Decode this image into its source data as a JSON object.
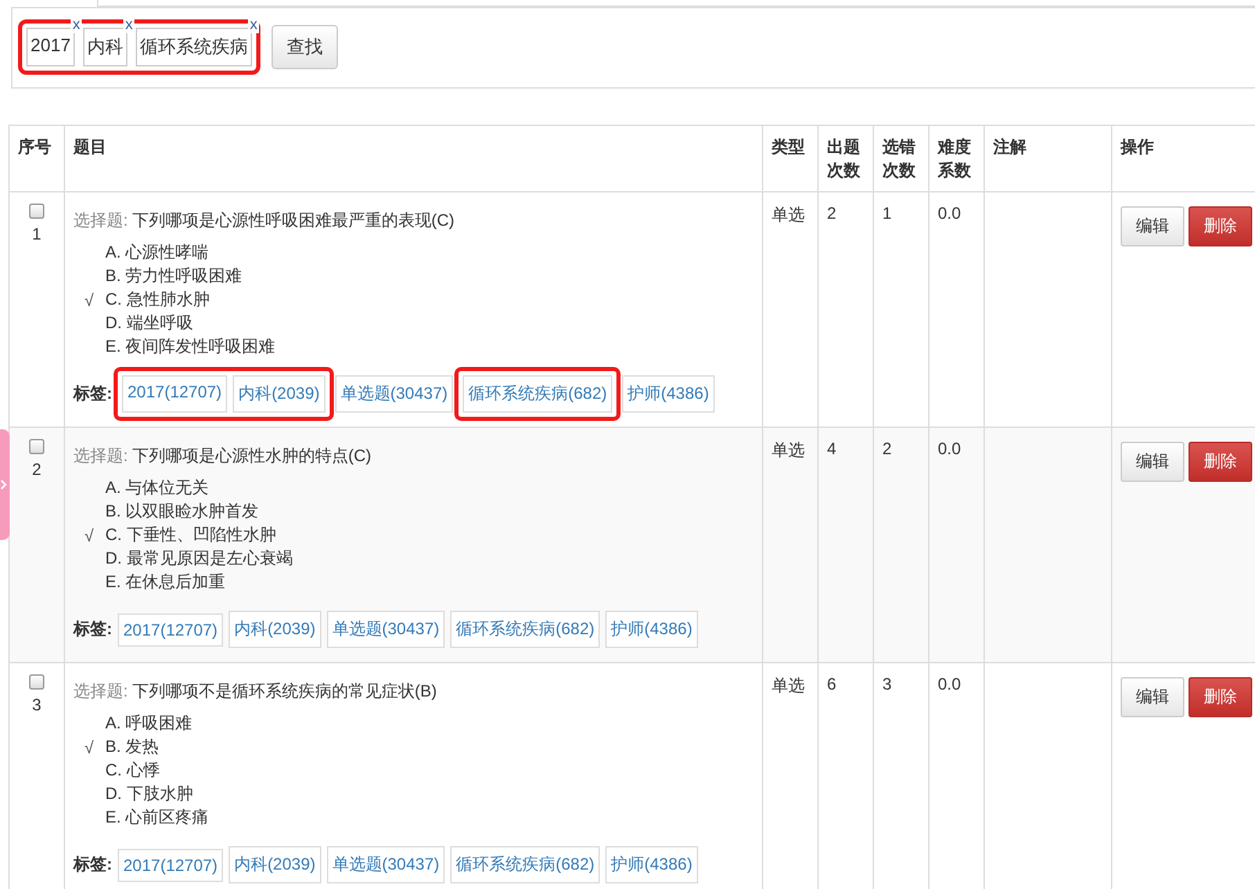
{
  "filters": {
    "highlighted": true,
    "chips": [
      {
        "label": "2017",
        "remove": "x"
      },
      {
        "label": "内科",
        "remove": "x"
      },
      {
        "label": "循环系统疾病",
        "remove": "x"
      }
    ],
    "search_button": "查找"
  },
  "table": {
    "columns": [
      "序号",
      "题目",
      "类型",
      "出题次数",
      "选错次数",
      "难度系数",
      "注解",
      "操作"
    ],
    "rows": [
      {
        "number": "1",
        "checked": false,
        "type_prefix": "选择题:",
        "question": "下列哪项是心源性呼吸困难最严重的表现(C)",
        "options": [
          {
            "text": "A. 心源性哮喘",
            "correct": false
          },
          {
            "text": "B. 劳力性呼吸困难",
            "correct": false
          },
          {
            "text": "C. 急性肺水肿",
            "correct": true
          },
          {
            "text": "D. 端坐呼吸",
            "correct": false
          },
          {
            "text": "E. 夜间阵发性呼吸困难",
            "correct": false
          }
        ],
        "correct_mark": "√",
        "tags_label": "标签:",
        "tags": [
          {
            "text": "2017(12707)",
            "highlighted": true
          },
          {
            "text": "内科(2039)",
            "highlighted": true
          },
          {
            "text": "单选题(30437)",
            "highlighted": false
          },
          {
            "text": "循环系统疾病(682)",
            "highlighted": true
          },
          {
            "text": "护师(4386)",
            "highlighted": false
          }
        ],
        "kind": "单选",
        "asked": "2",
        "wrong": "1",
        "difficulty": "0.0",
        "note_text": "",
        "edit": "编辑",
        "delete": "删除"
      },
      {
        "number": "2",
        "checked": false,
        "type_prefix": "选择题:",
        "question": "下列哪项是心源性水肿的特点(C)",
        "options": [
          {
            "text": "A. 与体位无关",
            "correct": false
          },
          {
            "text": "B. 以双眼睑水肿首发",
            "correct": false
          },
          {
            "text": "C. 下垂性、凹陷性水肿",
            "correct": true
          },
          {
            "text": "D. 最常见原因是左心衰竭",
            "correct": false
          },
          {
            "text": "E. 在休息后加重",
            "correct": false
          }
        ],
        "correct_mark": "√",
        "tags_label": "标签:",
        "tags": [
          {
            "text": "2017(12707)",
            "highlighted": false
          },
          {
            "text": "内科(2039)",
            "highlighted": false
          },
          {
            "text": "单选题(30437)",
            "highlighted": false
          },
          {
            "text": "循环系统疾病(682)",
            "highlighted": false
          },
          {
            "text": "护师(4386)",
            "highlighted": false
          }
        ],
        "kind": "单选",
        "asked": "4",
        "wrong": "2",
        "difficulty": "0.0",
        "note_text": "",
        "edit": "编辑",
        "delete": "删除"
      },
      {
        "number": "3",
        "checked": false,
        "type_prefix": "选择题:",
        "question": "下列哪项不是循环系统疾病的常见症状(B)",
        "options": [
          {
            "text": "A. 呼吸困难",
            "correct": false
          },
          {
            "text": "B. 发热",
            "correct": true
          },
          {
            "text": "C. 心悸",
            "correct": false
          },
          {
            "text": "D. 下肢水肿",
            "correct": false
          },
          {
            "text": "E. 心前区疼痛",
            "correct": false
          }
        ],
        "correct_mark": "√",
        "tags_label": "标签:",
        "tags": [
          {
            "text": "2017(12707)",
            "highlighted": false
          },
          {
            "text": "内科(2039)",
            "highlighted": false
          },
          {
            "text": "单选题(30437)",
            "highlighted": false
          },
          {
            "text": "循环系统疾病(682)",
            "highlighted": false
          },
          {
            "text": "护师(4386)",
            "highlighted": false
          }
        ],
        "kind": "单选",
        "asked": "6",
        "wrong": "3",
        "difficulty": "0.0",
        "note_text": "",
        "edit": "编辑",
        "delete": "删除"
      }
    ]
  }
}
